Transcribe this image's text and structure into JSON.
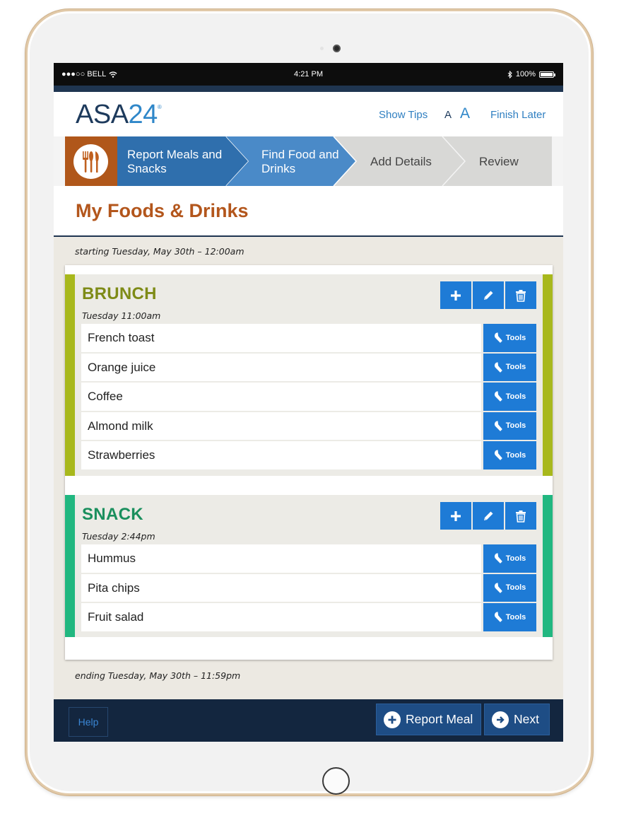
{
  "status_bar": {
    "carrier": "●●●○○ BELL",
    "time": "4:21 PM",
    "battery": "100%",
    "battery_level": 1.0
  },
  "header": {
    "logo_main": "ASA",
    "logo_number": "24",
    "logo_mark": "®",
    "show_tips": "Show Tips",
    "font_small": "A",
    "font_large": "A",
    "finish_later": "Finish Later"
  },
  "progress": {
    "steps": [
      {
        "label": "Report Meals and Snacks",
        "state": "done"
      },
      {
        "label": "Find Food and Drinks",
        "state": "current"
      },
      {
        "label": "Add Details",
        "state": "upcoming"
      },
      {
        "label": "Review",
        "state": "upcoming"
      }
    ]
  },
  "page_title": "My Foods & Drinks",
  "range": {
    "start": "starting Tuesday, May 30th – 12:00am",
    "end": "ending Tuesday, May 30th – 11:59pm"
  },
  "meals": [
    {
      "name": "BRUNCH",
      "time": "Tuesday 11:00am",
      "color": "#a8b81c",
      "items": [
        "French toast",
        "Orange juice",
        "Coffee",
        "Almond milk",
        "Strawberries"
      ]
    },
    {
      "name": "SNACK",
      "time": "Tuesday 2:44pm",
      "color": "#21b780",
      "items": [
        "Hummus",
        "Pita chips",
        "Fruit salad"
      ]
    }
  ],
  "tools_label": "Tools",
  "footer": {
    "help": "Help",
    "report_meal": "Report Meal",
    "next": "Next"
  },
  "colors": {
    "brand_navy": "#1d3a5c",
    "accent_blue": "#1e7bd6",
    "title_orange": "#b3561c"
  }
}
